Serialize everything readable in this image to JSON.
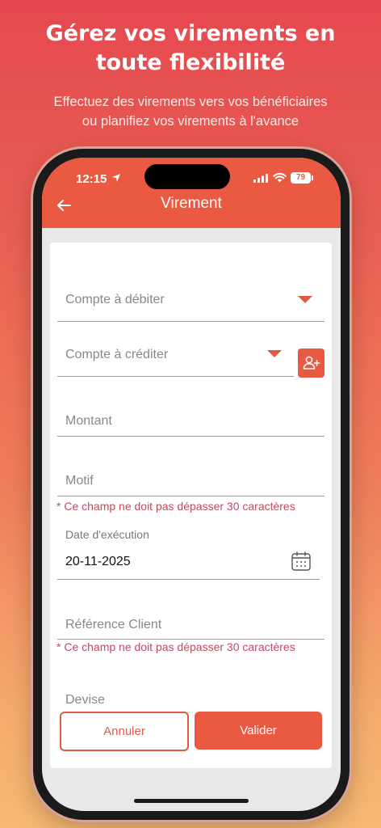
{
  "promo": {
    "headline_line1": "Gérez vos virements en",
    "headline_line2": "toute flexibilité",
    "subline_line1": "Effectuez des virements vers vos bénéficiaires",
    "subline_line2": "ou planifiez  vos virements à l'avance"
  },
  "status_bar": {
    "time": "12:15",
    "battery": "79"
  },
  "header": {
    "title": "Virement"
  },
  "form": {
    "debit_account_label": "Compte à débiter",
    "credit_account_label": "Compte à créditer",
    "amount_label": "Montant",
    "motif_label": "Motif",
    "motif_error": "* Ce champ ne doit pas dépasser 30 caractères",
    "execution_date_label": "Date d'exécution",
    "execution_date_value": "20-11-2025",
    "client_reference_label": "Référence Client",
    "client_reference_error": "* Ce champ ne doit pas dépasser 30 caractères",
    "currency_label": "Devise"
  },
  "actions": {
    "cancel_label": "Annuler",
    "validate_label": "Valider"
  },
  "colors": {
    "accent": "#ea5a43",
    "error": "#c04a62"
  }
}
